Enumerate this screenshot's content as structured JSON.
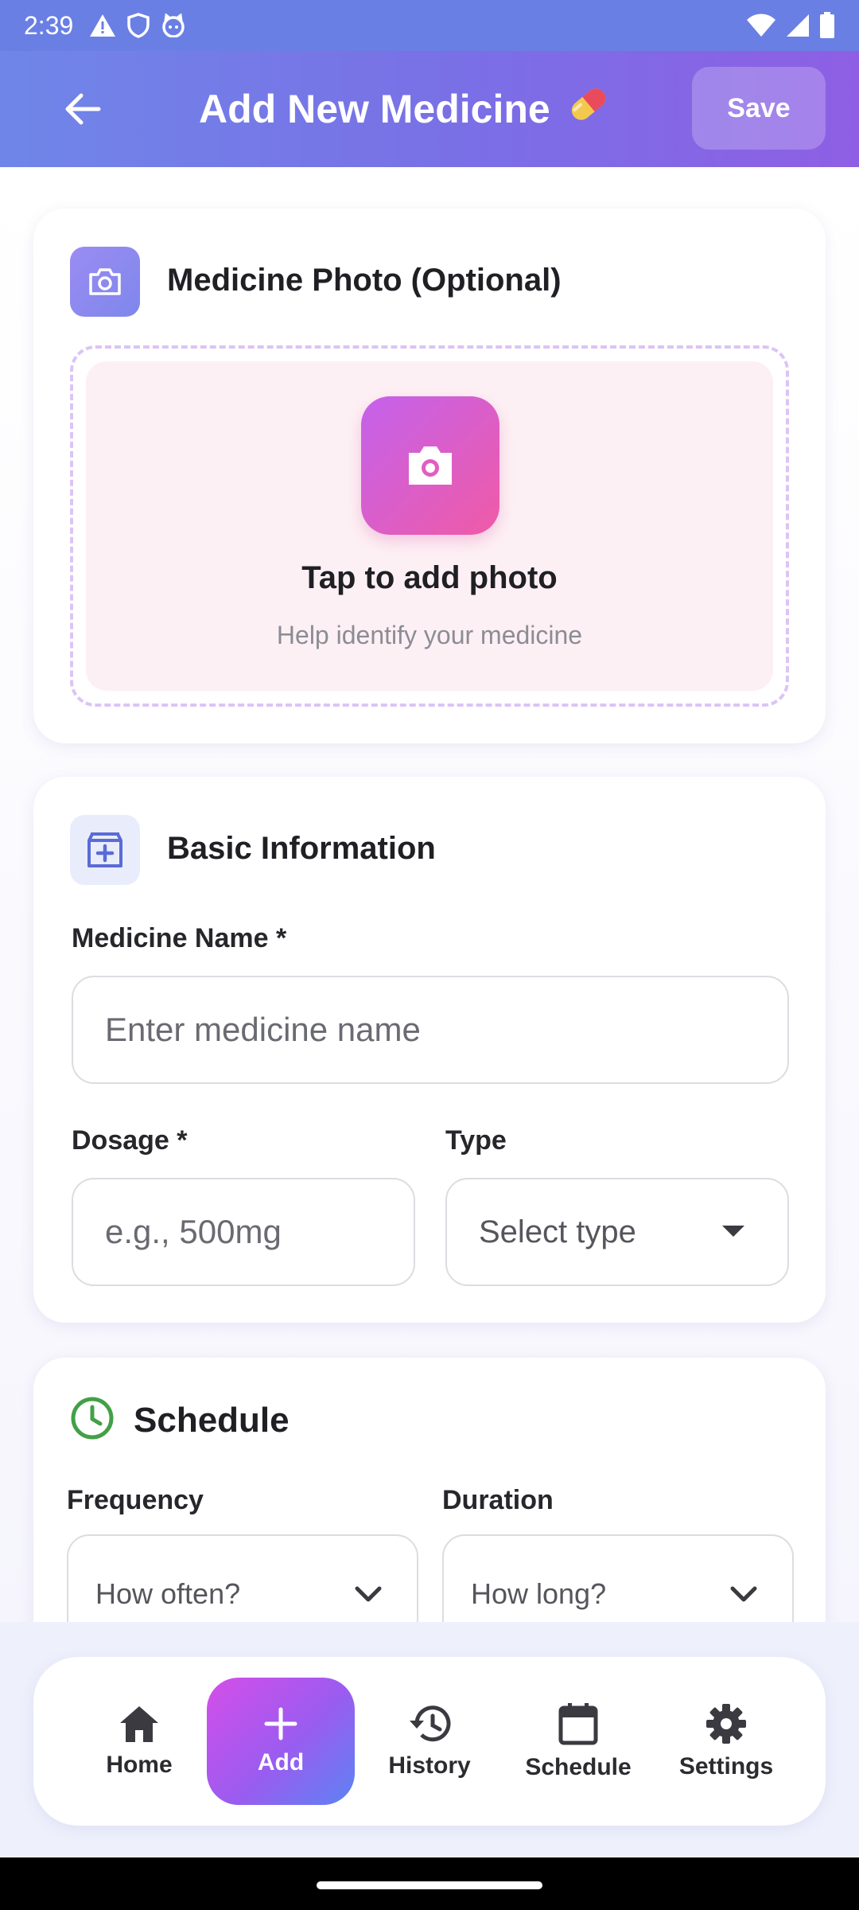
{
  "status_bar": {
    "time": "2:39",
    "icons_left": [
      "alert-icon",
      "shield-icon",
      "cat-face-icon"
    ],
    "icons_right": [
      "wifi-icon",
      "signal-icon",
      "battery-icon"
    ]
  },
  "header": {
    "title": "Add New Medicine",
    "emoji": "💊",
    "save_label": "Save",
    "gradient": [
      "#6f86e8",
      "#8e5fe4"
    ]
  },
  "photo_section": {
    "title": "Medicine Photo (Optional)",
    "cta_title": "Tap to add photo",
    "cta_subtitle": "Help identify your medicine",
    "accent": "#c462ec"
  },
  "basic_section": {
    "title": "Basic Information",
    "name_label": "Medicine Name *",
    "name_placeholder": "Enter medicine name",
    "dosage_label": "Dosage *",
    "dosage_placeholder": "e.g., 500mg",
    "type_label": "Type",
    "type_value": "Select type"
  },
  "schedule_section": {
    "title": "Schedule",
    "icon_color": "#43a047",
    "frequency_label": "Frequency",
    "frequency_value": "How often?",
    "duration_label": "Duration",
    "duration_value": "How long?"
  },
  "bottom_nav": {
    "items": [
      {
        "label": "Home",
        "icon": "home-icon"
      },
      {
        "label": "Add",
        "icon": "plus-icon",
        "active": true
      },
      {
        "label": "History",
        "icon": "history-icon"
      },
      {
        "label": "Schedule",
        "icon": "calendar-icon"
      },
      {
        "label": "Settings",
        "icon": "gear-icon"
      }
    ]
  }
}
